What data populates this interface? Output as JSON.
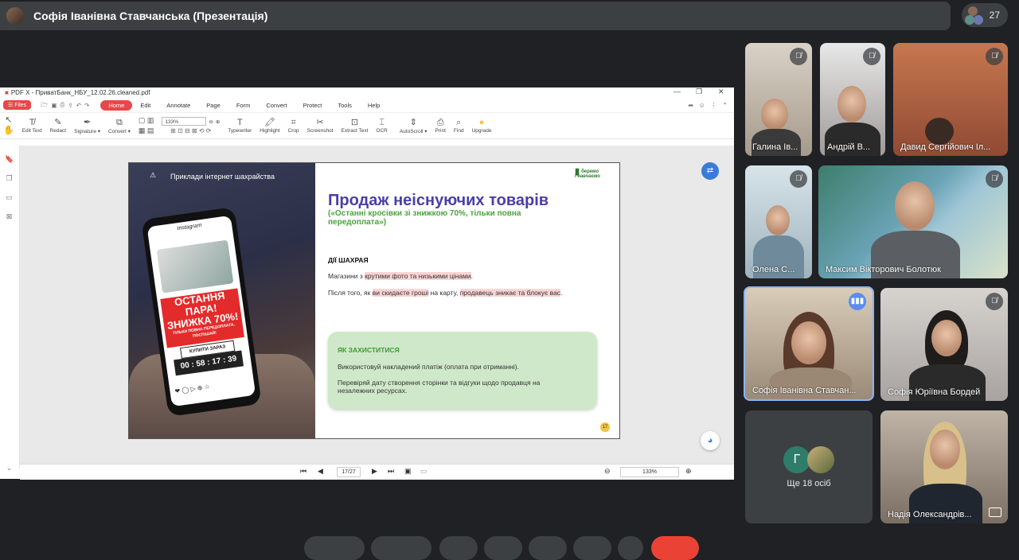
{
  "meeting": {
    "presenter_title": "Софія Іванівна Ставчанська (Презентація)",
    "participant_count": "27"
  },
  "pdf": {
    "window_title": "PDF X - ПриватБанк_НБУ_12.02.26.cleaned.pdf",
    "files_label": "Files",
    "menu": [
      "Home",
      "Edit",
      "Annotate",
      "Page",
      "Form",
      "Convert",
      "Protect",
      "Tools",
      "Help"
    ],
    "tools": [
      "Edit Text",
      "Redact",
      "Signature ▾",
      "Convert ▾",
      "Typewriter",
      "Highlight",
      "Crop",
      "Screenshot",
      "Extract Text",
      "OCR",
      "AutoScroll ▾",
      "Print",
      "Find",
      "Upgrade"
    ],
    "zoom": "133%",
    "page_indicator": "17/27",
    "zoom_bottom": "133%"
  },
  "slide": {
    "header_label": "Приклади інтернет шахрайства",
    "logo_line1": "беремо",
    "logo_line2": "і навчаємо",
    "title": "Продаж неіснуючих товарів",
    "subtitle": "(«Останні кросівки зі знижкою 70%, тільки повна передоплата»)",
    "section1": "ДІЇ ШАХРАЯ",
    "p1_a": "Магазини з ",
    "p1_hl": "крутими фото та низькими цінами",
    "p1_b": ".",
    "p2_a": "Після того, як ",
    "p2_hl1": "ви скидаєте гроші",
    "p2_b": " на карту, ",
    "p2_hl2": "продавець зникає та блокує вас",
    "p2_c": ".",
    "section2": "ЯК ЗАХИСТИТИСЯ",
    "g1": "Використовуй накладений платіж (оплата при отриманні).",
    "g2": "Перевіряй дату створення сторінки та відгуки щодо продавця на незалежних ресурсах.",
    "page_number": "17",
    "phone_app": "Instagram",
    "promo_line1": "ОСТАННЯ ПАРА!",
    "promo_line2": "ЗНИЖКА 70%!",
    "promo_note": "ТІЛЬКИ ПОВНА ПЕРЕДОПЛАТА. ПОСПІШАЙ!",
    "buy_button": "КУПИТИ ЗАРАЗ",
    "timer": "00 : 58 : 17 : 39"
  },
  "participants": [
    {
      "name": "Галина Ів..."
    },
    {
      "name": "Андрій В..."
    },
    {
      "name": "Давид Сергійович Іл..."
    },
    {
      "name": "Олена С..."
    },
    {
      "name": "Максим Вікторович Болотюк"
    },
    {
      "name": "Софія Іванівна Ставчан..."
    },
    {
      "name": "Софія Юріївна Бордей"
    },
    {
      "name": "Надія Олександрів..."
    }
  ],
  "others": {
    "label": "Ще 18 осіб",
    "initial": "Г"
  }
}
